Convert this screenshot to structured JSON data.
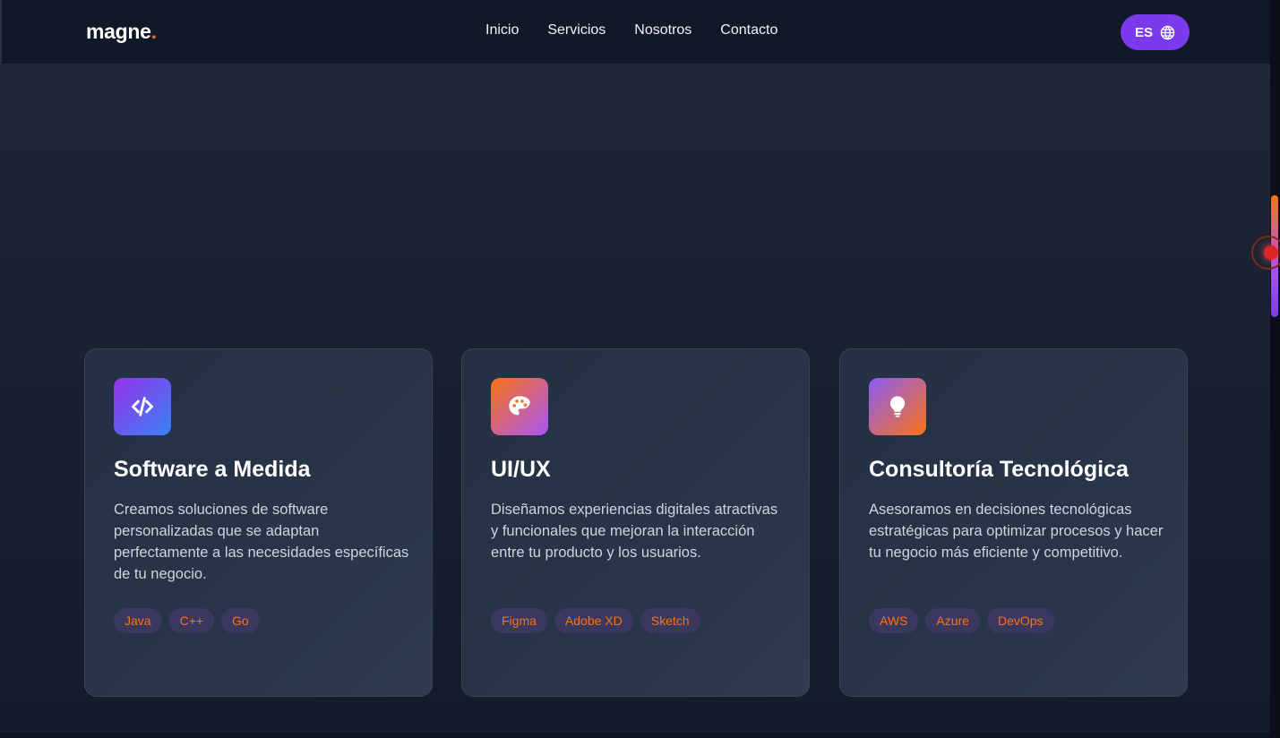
{
  "header": {
    "logo_text": "magne",
    "logo_dot": ".",
    "nav": [
      "Inicio",
      "Servicios",
      "Nosotros",
      "Contacto"
    ],
    "lang_label": "ES"
  },
  "services": [
    {
      "icon": "code-icon",
      "title": "Software a Medida",
      "description": "Creamos soluciones de software personalizadas que se adaptan perfectamente a las necesidades específicas de tu negocio.",
      "tags": [
        "Java",
        "C++",
        "Go"
      ]
    },
    {
      "icon": "palette-icon",
      "title": "UI/UX",
      "description": "Diseñamos experiencias digitales atractivas y funcionales que mejoran la interacción entre tu producto y los usuarios.",
      "tags": [
        "Figma",
        "Adobe XD",
        "Sketch"
      ]
    },
    {
      "icon": "lightbulb-icon",
      "title": "Consultoría Tecnológica",
      "description": "Asesoramos en decisiones tecnológicas estratégicas para optimizar procesos y hacer tu negocio más eficiente y competitivo.",
      "tags": [
        "AWS",
        "Azure",
        "DevOps"
      ]
    }
  ],
  "colors": {
    "accent": "#7c3aed",
    "brand_orange": "#f97316",
    "background": "#111827"
  }
}
